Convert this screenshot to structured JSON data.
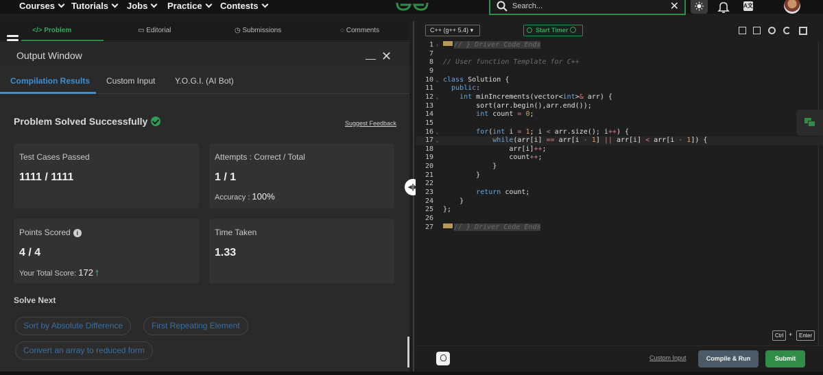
{
  "nav": {
    "items": [
      "Courses",
      "Tutorials",
      "Jobs",
      "Practice",
      "Contests"
    ],
    "search_placeholder": "Search...",
    "close_glyph": "✕",
    "lang_glyph": "A文"
  },
  "problem_tabs": [
    {
      "label": "</> Problem"
    },
    {
      "label": "Editorial"
    },
    {
      "label": "Submissions"
    },
    {
      "label": "Comments"
    }
  ],
  "output": {
    "title": "Output Window",
    "close_glyph": "✕",
    "tabs": [
      "Compilation Results",
      "Custom Input",
      "Y.O.G.I. (AI Bot)"
    ],
    "status": "Problem Solved Successfully",
    "feedback_link": "Suggest Feedback",
    "cards": {
      "tests": {
        "label": "Test Cases Passed",
        "value": "1111 / 1111"
      },
      "attempts": {
        "label": "Attempts : Correct / Total",
        "value": "1 / 1",
        "accuracy_label": "Accuracy :",
        "accuracy_value": "100%"
      },
      "points": {
        "label": "Points Scored",
        "value": "4 / 4",
        "total_label": "Your Total Score:",
        "total_value": "172",
        "info_glyph": "i"
      },
      "time": {
        "label": "Time Taken",
        "value": "1.33"
      }
    },
    "solve_next_title": "Solve Next",
    "suggestions": [
      "Sort by Absolute Difference",
      "First Repeating Element",
      "Convert an array to reduced form"
    ]
  },
  "editor": {
    "language": "C++ (g++ 5.4)",
    "timer_label": "Start Timer",
    "current_line": 17,
    "lines": [
      {
        "n": "1",
        "fold": "›",
        "code": "<span class='tk-foldmark'></span><span class='tk-fold'>// } Driver Code Ends</span>"
      },
      {
        "n": "7",
        "fold": "",
        "code": ""
      },
      {
        "n": "8",
        "fold": "",
        "code": "<span class='tk-cm'>// User function Template for C++</span>"
      },
      {
        "n": "9",
        "fold": "",
        "code": ""
      },
      {
        "n": "10",
        "fold": "⌄",
        "code": "<span class='tk-kw'>class</span> Solution {"
      },
      {
        "n": "11",
        "fold": "",
        "code": "  <span class='tk-kw'>public</span>:"
      },
      {
        "n": "12",
        "fold": "⌄",
        "code": "    <span class='tk-kw'>int</span> minIncrements(vector&lt;<span class='tk-kw'>int</span>&gt;<span class='tk-op'>&amp;</span> arr) {"
      },
      {
        "n": "13",
        "fold": "",
        "code": "        sort(arr.begin(),arr.end());"
      },
      {
        "n": "14",
        "fold": "",
        "code": "        <span class='tk-kw'>int</span> count <span class='tk-op'>=</span> <span class='tk-num'>0</span>;"
      },
      {
        "n": "15",
        "fold": "",
        "code": ""
      },
      {
        "n": "16",
        "fold": "⌄",
        "code": "        <span class='tk-kw'>for</span>(<span class='tk-kw'>int</span> i <span class='tk-op'>=</span> <span class='tk-num'>1</span>; i <span class='tk-op'>&lt;</span> arr.size(); i<span class='tk-op'>++</span>) {"
      },
      {
        "n": "17",
        "fold": "⌄",
        "code": "            <span class='tk-kw'>while</span>(arr[i] <span class='tk-op'>==</span> arr[i <span class='tk-op'>-</span> <span class='tk-num'>1</span>] <span class='tk-op'>||</span> arr[i] <span class='tk-op'>&lt;</span> arr[i <span class='tk-op'>-</span> <span class='tk-num'>1</span>]) {"
      },
      {
        "n": "18",
        "fold": "",
        "code": "                arr[i]<span class='tk-op'>++</span>;"
      },
      {
        "n": "19",
        "fold": "",
        "code": "                count<span class='tk-op'>++</span>;"
      },
      {
        "n": "20",
        "fold": "",
        "code": "            }"
      },
      {
        "n": "21",
        "fold": "",
        "code": "        }"
      },
      {
        "n": "22",
        "fold": "",
        "code": ""
      },
      {
        "n": "23",
        "fold": "",
        "code": "        <span class='tk-kw'>return</span> count;"
      },
      {
        "n": "24",
        "fold": "",
        "code": "    }"
      },
      {
        "n": "25",
        "fold": "",
        "code": "};"
      },
      {
        "n": "26",
        "fold": "",
        "code": ""
      },
      {
        "n": "27",
        "fold": "",
        "code": "<span class='tk-foldmark'></span><span class='tk-fold'>// } Driver Code Ends</span>"
      }
    ]
  },
  "shortcut": {
    "key1": "Ctrl",
    "plus": "+",
    "key2": "Enter"
  },
  "footer": {
    "custom_input": "Custom Input",
    "compile_run": "Compile & Run",
    "submit": "Submit"
  },
  "colors": {
    "brand_green": "#2f8d46",
    "accent_blue": "#3e8ed0",
    "bg_dark": "#1e1e1e"
  },
  "icons": [
    "search-icon",
    "close-icon",
    "theme-toggle-icon",
    "bell-icon",
    "language-icon",
    "avatar",
    "hamburger-icon",
    "check-circle-icon",
    "info-icon",
    "arrow-up-icon",
    "chat-icon",
    "bulb-icon"
  ]
}
